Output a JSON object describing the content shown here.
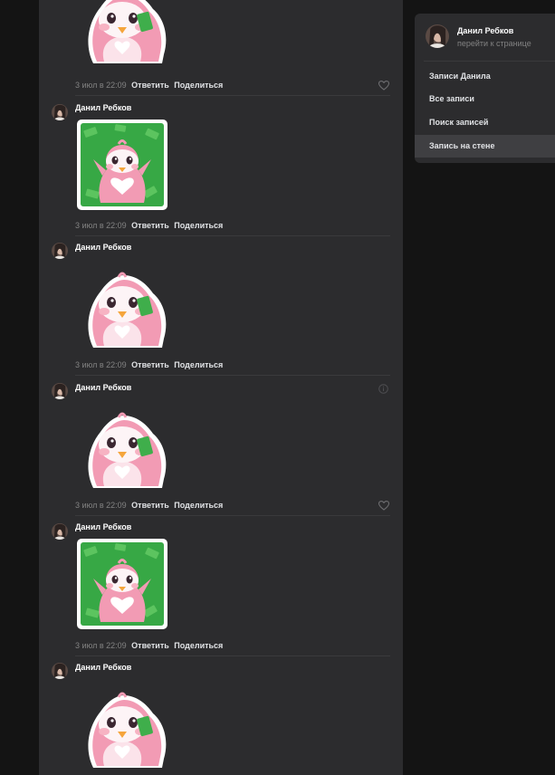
{
  "sidebar": {
    "profile_name": "Данил Ребков",
    "profile_link": "перейти к странице",
    "items": [
      {
        "label": "Записи Данила"
      },
      {
        "label": "Все записи"
      },
      {
        "label": "Поиск записей"
      },
      {
        "label": "Запись на стене"
      }
    ]
  },
  "comments": [
    {
      "author": "",
      "sticker": "penguin-cry",
      "time": "3 июл в 22:09",
      "reply": "Ответить",
      "share": "Поделиться"
    },
    {
      "author": "Данил Ребков",
      "sticker": "penguin-money",
      "time": "3 июл в 22:09",
      "reply": "Ответить",
      "share": "Поделиться"
    },
    {
      "author": "Данил Ребков",
      "sticker": "penguin-cry",
      "time": "3 июл в 22:09",
      "reply": "Ответить",
      "share": "Поделиться"
    },
    {
      "author": "Данил Ребков",
      "sticker": "penguin-cry",
      "time": "3 июл в 22:09",
      "reply": "Ответить",
      "share": "Поделиться"
    },
    {
      "author": "Данил Ребков",
      "sticker": "penguin-money",
      "time": "3 июл в 22:09",
      "reply": "Ответить",
      "share": "Поделиться"
    },
    {
      "author": "Данил Ребков",
      "sticker": "penguin-cry",
      "time": "",
      "reply": "",
      "share": ""
    }
  ]
}
